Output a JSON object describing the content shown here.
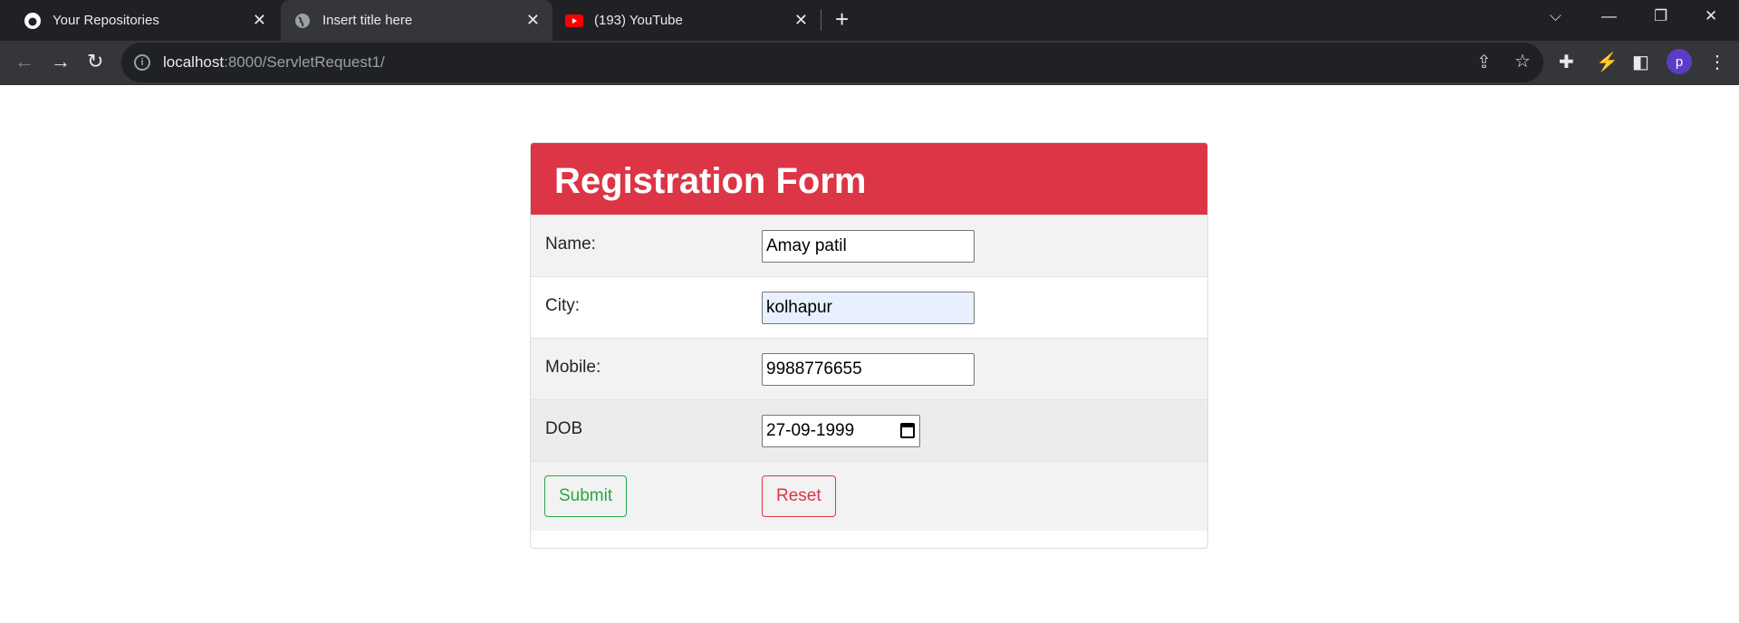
{
  "browser": {
    "tabs": [
      {
        "title": "Your Repositories",
        "icon": "github-icon",
        "active": false
      },
      {
        "title": "Insert title here",
        "icon": "globe-icon",
        "active": true
      },
      {
        "title": "(193) YouTube",
        "icon": "youtube-icon",
        "active": false
      }
    ],
    "url_host": "localhost",
    "url_path": ":8000/ServletRequest1/",
    "profile_initial": "p"
  },
  "form": {
    "title": "Registration Form",
    "fields": [
      {
        "label": "Name:",
        "value": "Amay patil"
      },
      {
        "label": "City:",
        "value": "kolhapur"
      },
      {
        "label": "Mobile:",
        "value": "9988776655"
      },
      {
        "label": "DOB",
        "value": "27-09-1999"
      }
    ],
    "submit_label": "Submit",
    "reset_label": "Reset"
  },
  "colors": {
    "header": "#dc3545",
    "submit": "#28a745",
    "reset": "#dc3545"
  }
}
